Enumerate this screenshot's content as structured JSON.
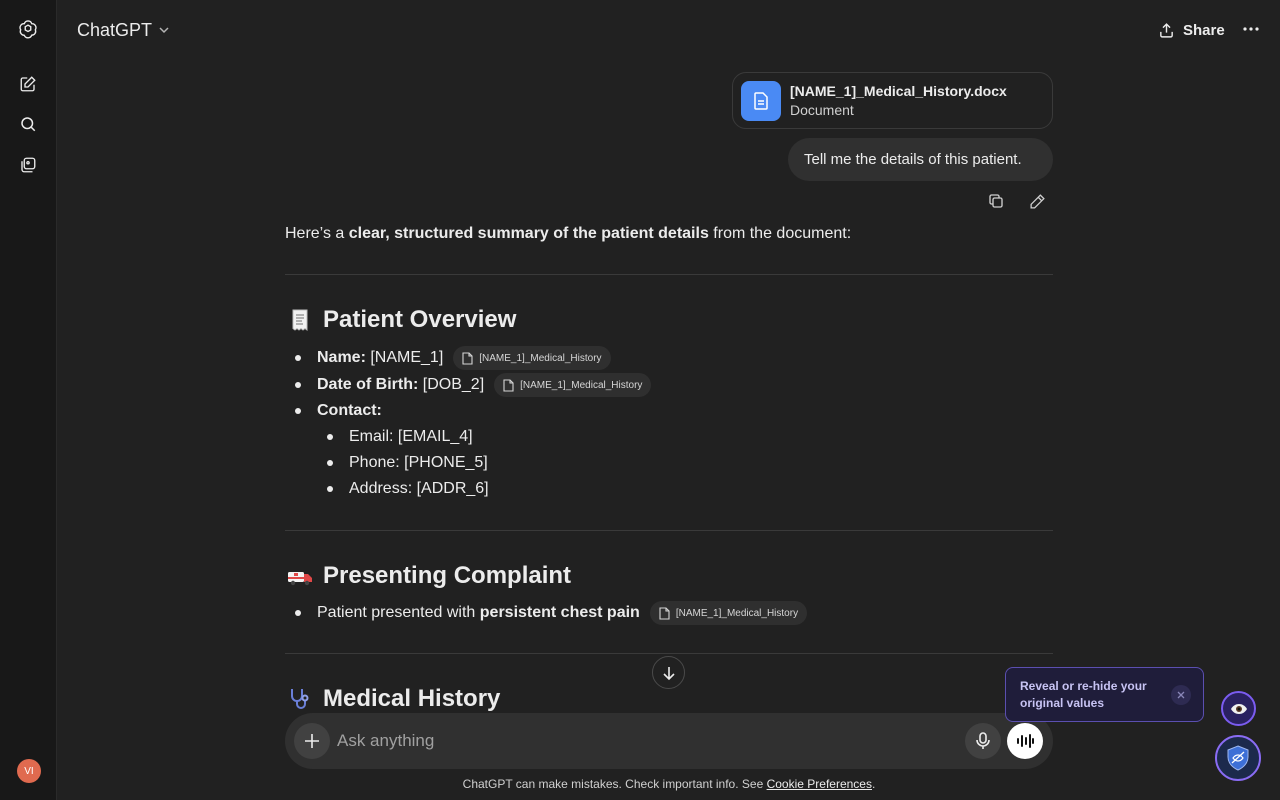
{
  "app": {
    "model_label": "ChatGPT",
    "share_label": "Share"
  },
  "sidebar": {
    "avatar_initials": "VI"
  },
  "attachment": {
    "file_name": "[NAME_1]_Medical_History.docx",
    "file_type": "Document"
  },
  "user_message": "Tell me the details of this patient.",
  "assistant": {
    "intro_prefix": "Here’s a ",
    "intro_bold": "clear, structured summary of the patient details",
    "intro_suffix": " from the document:",
    "sections": {
      "overview": {
        "heading": "Patient Overview",
        "name_label": "Name:",
        "name_value": " [NAME_1]",
        "dob_label": "Date of Birth:",
        "dob_value": " [DOB_2]",
        "contact_label": "Contact:",
        "email": "Email: [EMAIL_4]",
        "phone": "Phone: [PHONE_5]",
        "address": "Address: [ADDR_6]"
      },
      "complaint": {
        "heading": "Presenting Complaint",
        "text_prefix": "Patient presented with ",
        "text_bold": "persistent chest pain"
      },
      "history": {
        "heading": "Medical History"
      }
    },
    "citation_label": "[NAME_1]_Medical_History"
  },
  "composer": {
    "placeholder": "Ask anything"
  },
  "footer": {
    "disclaimer": "ChatGPT can make mistakes. Check important info. See ",
    "link": "Cookie Preferences",
    "end": "."
  },
  "privacy_widget": {
    "tooltip_line1": "Reveal or re-hide your",
    "tooltip_line2": "original values"
  },
  "colors": {
    "background": "#212121",
    "sidebar": "#181818",
    "bubble": "#303030",
    "file_icon": "#4a8af4",
    "accent_purple": "#7b5cf0"
  }
}
